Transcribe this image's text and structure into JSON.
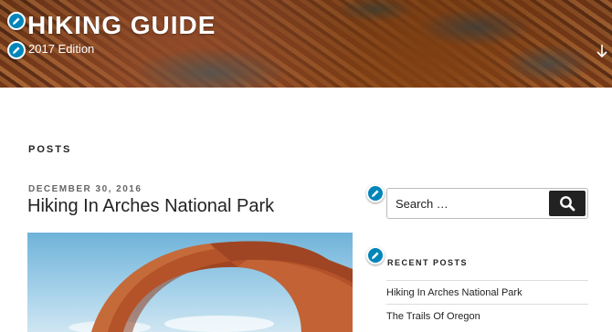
{
  "header": {
    "site_title": "HIKING GUIDE",
    "site_description": "2017 Edition"
  },
  "content": {
    "section_heading": "POSTS",
    "post": {
      "date": "DECEMBER 30, 2016",
      "title": "Hiking In Arches National Park"
    }
  },
  "sidebar": {
    "search": {
      "placeholder": "Search …"
    },
    "recent_posts": {
      "title": "RECENT POSTS",
      "items": [
        {
          "label": "Hiking In Arches National Park"
        },
        {
          "label": "The Trails Of Oregon"
        }
      ]
    }
  },
  "colors": {
    "edit_shortcut": "#0085ba",
    "search_button": "#222222",
    "text": "#222222"
  },
  "icons": {
    "edit": "pencil-icon",
    "scroll": "arrow-down-icon",
    "search": "search-icon"
  }
}
